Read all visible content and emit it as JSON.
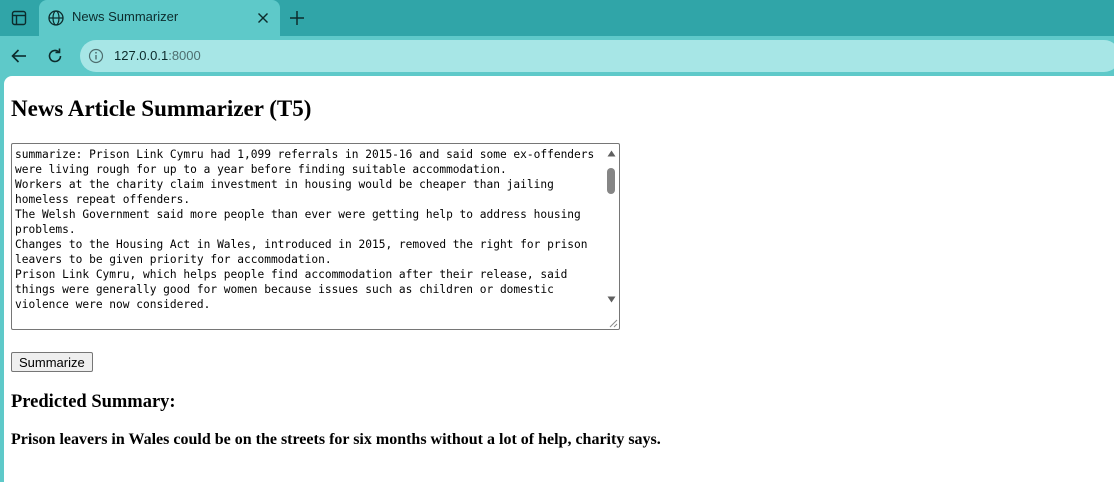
{
  "browser": {
    "tab_title": "News Summarizer",
    "url_host": "127.0.0.1",
    "url_port": ":8000",
    "icons": {
      "sidebar": "tab-sidebar-icon",
      "globe": "globe-icon",
      "close": "close-icon",
      "new_tab": "plus-icon",
      "back": "back-arrow-icon",
      "reload": "reload-icon",
      "site_info": "info-icon"
    },
    "colors": {
      "tab_strip": "#30a5a8",
      "toolbar": "#5ec9c9",
      "omnibox": "#a7e6e6"
    }
  },
  "page": {
    "title": "News Article Summarizer (T5)",
    "article_text": "summarize: Prison Link Cymru had 1,099 referrals in 2015-16 and said some ex-offenders were living rough for up to a year before finding suitable accommodation.\nWorkers at the charity claim investment in housing would be cheaper than jailing homeless repeat offenders.\nThe Welsh Government said more people than ever were getting help to address housing problems.\nChanges to the Housing Act in Wales, introduced in 2015, removed the right for prison leavers to be given priority for accommodation.\nPrison Link Cymru, which helps people find accommodation after their release, said things were generally good for women because issues such as children or domestic violence were now considered.",
    "summarize_button": "Summarize",
    "summary_heading": "Predicted Summary:",
    "summary_text": "Prison leavers in Wales could be on the streets for six months without a lot of help, charity says."
  }
}
